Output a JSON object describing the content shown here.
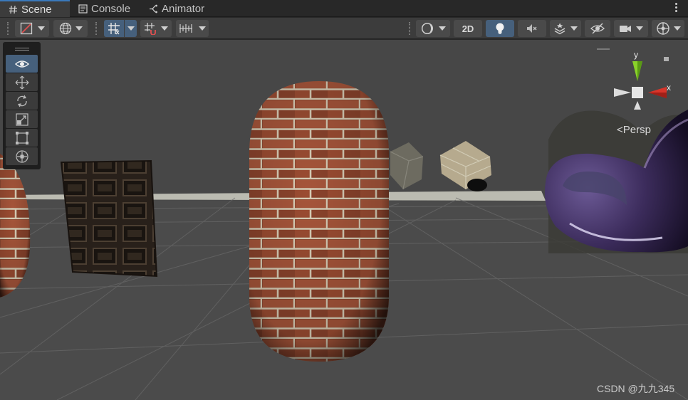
{
  "tabs": [
    {
      "label": "Scene",
      "icon": "hash-icon",
      "active": true
    },
    {
      "label": "Console",
      "icon": "console-icon",
      "active": false
    },
    {
      "label": "Animator",
      "icon": "animator-icon",
      "active": false
    }
  ],
  "toolbar": {
    "toggle_2d_label": "2D"
  },
  "gizmo": {
    "axis_y": "y",
    "axis_x": "x",
    "projection_label": "<Persp"
  },
  "watermark": "CSDN @九九345",
  "colors": {
    "accent": "#46607c",
    "tab_highlight": "#3a79bb",
    "axis_y": "#8ad12a",
    "axis_x": "#d9352a"
  }
}
